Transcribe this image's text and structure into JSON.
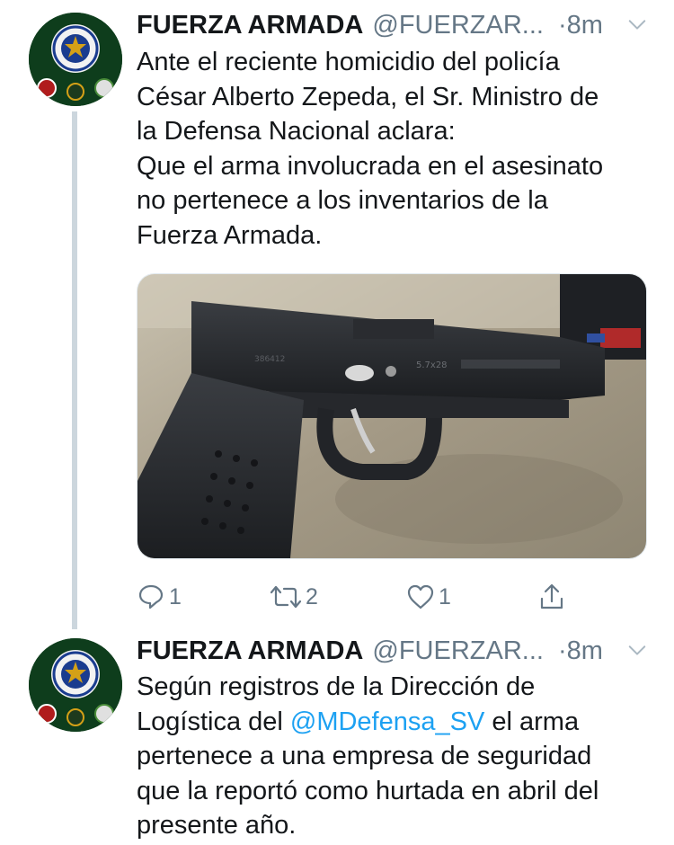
{
  "tweets": [
    {
      "name": "FUERZA ARMADA",
      "handle": "@FUERZAR...",
      "time": "·8m",
      "text": "Ante el reciente homicidio del policía\nCésar Alberto Zepeda, el Sr. Ministro de\nla Defensa Nacional aclara:\nQue el arma involucrada en el asesinato\nno pertenece a los inventarios de la\nFuerza Armada.",
      "image_alt": "photo of a black pistol",
      "image_markings": {
        "model": "5.7x28",
        "serial": "386412"
      },
      "replies": "1",
      "retweets": "2",
      "likes": "1"
    },
    {
      "name": "FUERZA ARMADA",
      "handle": "@FUERZAR...",
      "time": "·8m",
      "text_before": "Según registros de la Dirección de\nLogística del ",
      "mention": "@MDefensa_SV",
      "text_after": " el arma\npertenece a una empresa de seguridad\nque la reportó como hurtada en abril del\npresente año."
    }
  ],
  "colors": {
    "text": "#14171a",
    "secondary": "#657786",
    "link": "#1da1f2",
    "thread_line": "#ccd6dd",
    "avatar_bg": "#0e3d1c"
  },
  "icons": {
    "reply": "reply-icon",
    "retweet": "retweet-icon",
    "like": "heart-icon",
    "share": "share-icon",
    "menu": "chevron-down-icon"
  }
}
